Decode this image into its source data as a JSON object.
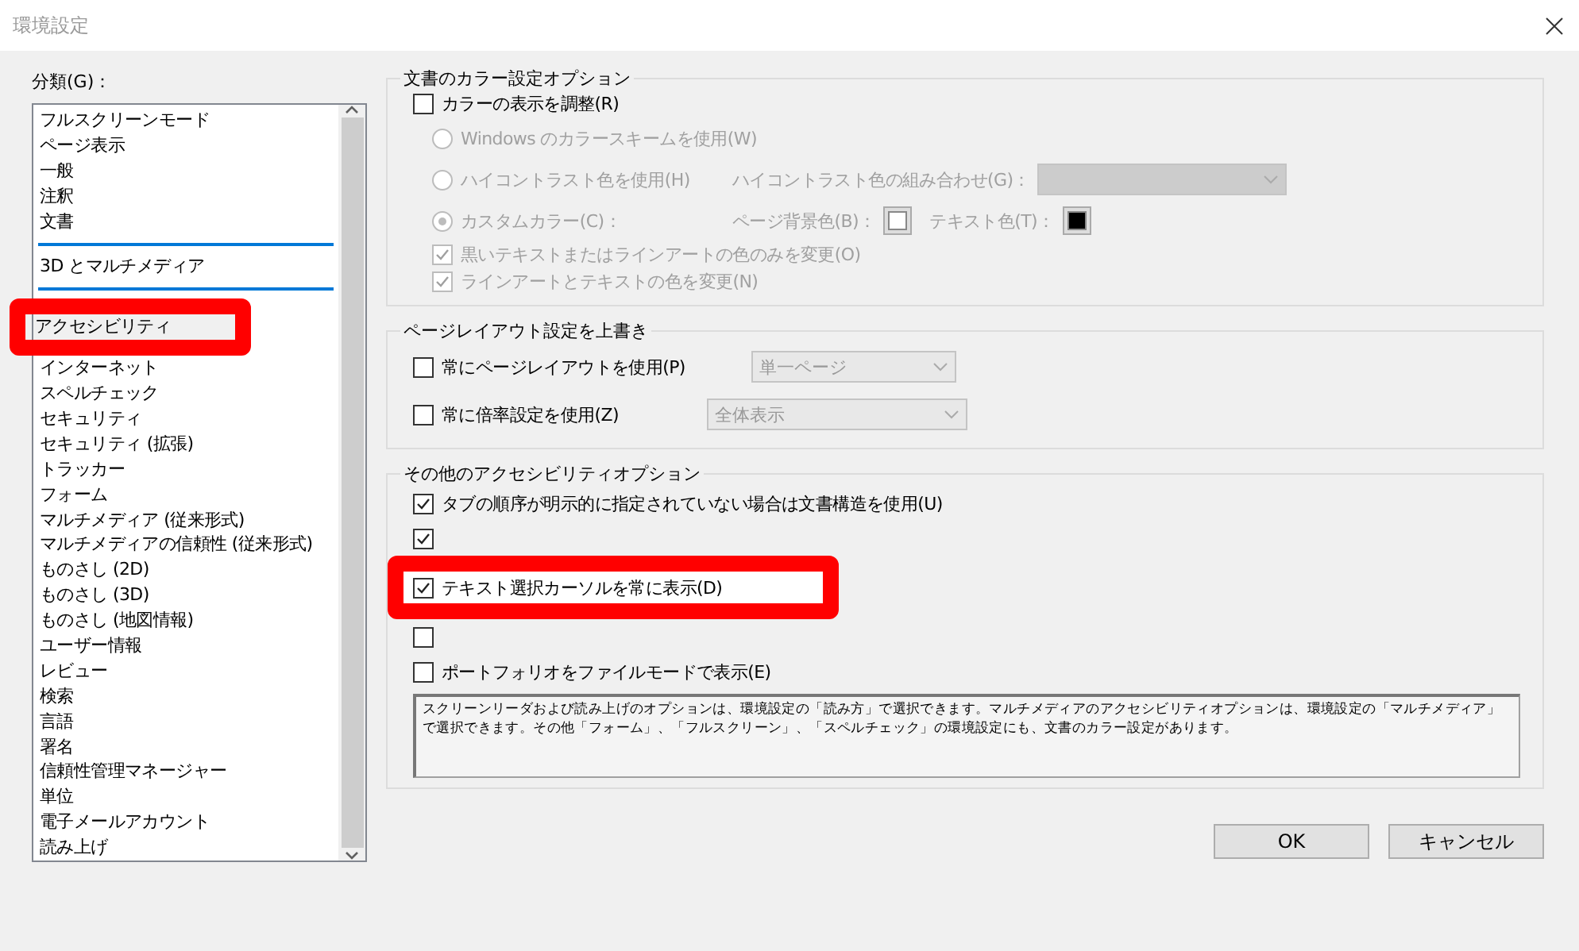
{
  "window": {
    "title": "環境設定"
  },
  "sidebar": {
    "label": "分類(G)：",
    "items": [
      {
        "kind": "item",
        "label": "フルスクリーンモード",
        "selected": false
      },
      {
        "kind": "item",
        "label": "ページ表示",
        "selected": false
      },
      {
        "kind": "item",
        "label": "一般",
        "selected": false
      },
      {
        "kind": "item",
        "label": "注釈",
        "selected": false
      },
      {
        "kind": "item",
        "label": "文書",
        "selected": false
      },
      {
        "kind": "divider"
      },
      {
        "kind": "item",
        "label": "3D とマルチメディア",
        "selected": false
      },
      {
        "kind": "divider"
      },
      {
        "kind": "framed",
        "label": "アクセシビリティ",
        "selected": true
      },
      {
        "kind": "item",
        "label": "インターネット",
        "selected": false
      },
      {
        "kind": "item",
        "label": "スペルチェック",
        "selected": false
      },
      {
        "kind": "item",
        "label": "セキュリティ",
        "selected": false
      },
      {
        "kind": "item",
        "label": "セキュリティ (拡張)",
        "selected": false
      },
      {
        "kind": "item",
        "label": "トラッカー",
        "selected": false
      },
      {
        "kind": "item",
        "label": "フォーム",
        "selected": false
      },
      {
        "kind": "item",
        "label": "マルチメディア (従来形式)",
        "selected": false
      },
      {
        "kind": "item",
        "label": "マルチメディアの信頼性 (従来形式)",
        "selected": false
      },
      {
        "kind": "item",
        "label": "ものさし (2D)",
        "selected": false
      },
      {
        "kind": "item",
        "label": "ものさし (3D)",
        "selected": false
      },
      {
        "kind": "item",
        "label": "ものさし (地図情報)",
        "selected": false
      },
      {
        "kind": "item",
        "label": "ユーザー情報",
        "selected": false
      },
      {
        "kind": "item",
        "label": "レビュー",
        "selected": false
      },
      {
        "kind": "item",
        "label": "検索",
        "selected": false
      },
      {
        "kind": "item",
        "label": "言語",
        "selected": false
      },
      {
        "kind": "item",
        "label": "署名",
        "selected": false
      },
      {
        "kind": "item",
        "label": "信頼性管理マネージャー",
        "selected": false
      },
      {
        "kind": "item",
        "label": "単位",
        "selected": false
      },
      {
        "kind": "item",
        "label": "電子メールアカウント",
        "selected": false
      },
      {
        "kind": "item",
        "label": "読み上げ",
        "selected": false
      }
    ]
  },
  "color_options": {
    "title": "文書のカラー設定オプション",
    "adjust": {
      "label": "カラーの表示を調整(R)",
      "checked": false
    },
    "radios": [
      {
        "label": "Windows のカラースキームを使用(W)",
        "selected": false,
        "disabled": true
      },
      {
        "label": "ハイコントラスト色を使用(H)",
        "selected": false,
        "disabled": true
      },
      {
        "label": "カスタムカラー(C)：",
        "selected": true,
        "disabled": true
      }
    ],
    "contrast_combo": {
      "label": "ハイコントラスト色の組み合わせ(G)："
    },
    "page_bg": {
      "label": "ページ背景色(B)：",
      "color": "#ffffff"
    },
    "text_color": {
      "label": "テキスト色(T)：",
      "color": "#000000"
    },
    "checks": [
      {
        "label": "黒いテキストまたはラインアートの色のみを変更(O)",
        "checked": true,
        "disabled": true
      },
      {
        "label": "ラインアートとテキストの色を変更(N)",
        "checked": true,
        "disabled": true
      }
    ]
  },
  "page_layout": {
    "title": "ページレイアウト設定を上書き",
    "rows": [
      {
        "label": "常にページレイアウトを使用(P)",
        "checked": false,
        "value": "単一ページ"
      },
      {
        "label": "常に倍率設定を使用(Z)",
        "checked": false,
        "value": "全体表示"
      }
    ]
  },
  "other_options": {
    "title": "その他のアクセシビリティオプション",
    "checks": [
      {
        "label": "タブの順序が明示的に指定されていない場合は文書構造を使用(U)",
        "checked": true
      },
      {
        "checked": true
      },
      {
        "label": "テキスト選択カーソルを常に表示(D)",
        "checked": true,
        "framed": true
      },
      {
        "checked": false
      },
      {
        "label": "ポートフォリオをファイルモードで表示(E)",
        "checked": false
      }
    ],
    "note": "スクリーンリーダおよび読み上げのオプションは、環境設定の「読み方」で選択できます。マルチメディアのアクセシビリティオプションは、環境設定の「マルチメディア」で選択できます。その他「フォーム」、「フルスクリーン」、「スペルチェック」の環境設定にも、文書のカラー設定があります。"
  },
  "buttons": [
    "OK",
    "キャンセル"
  ]
}
